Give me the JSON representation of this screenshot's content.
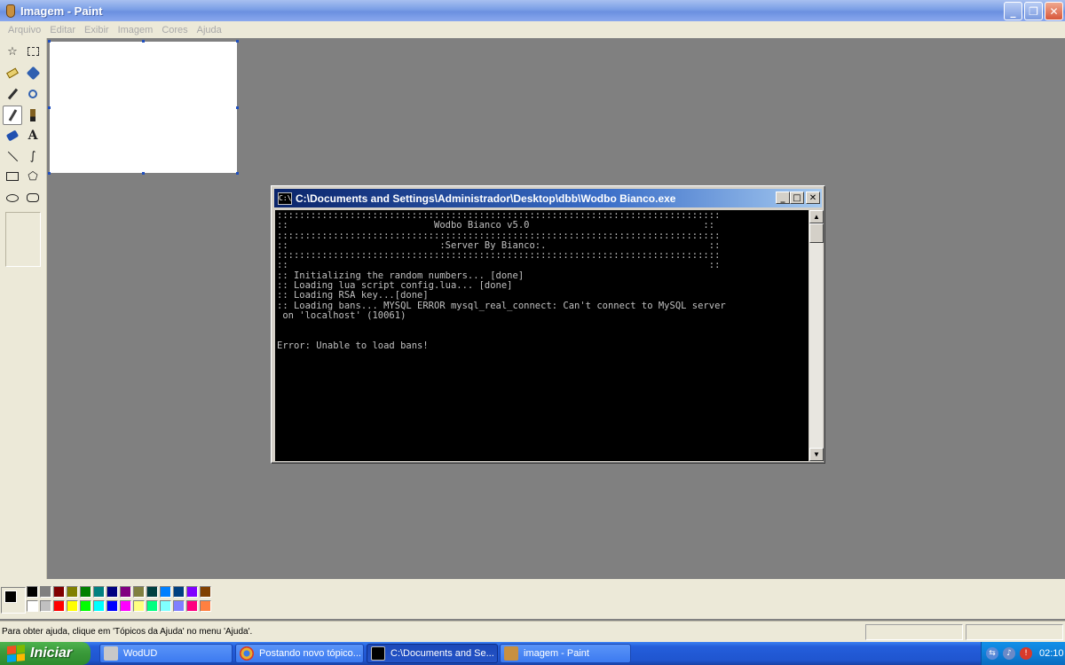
{
  "window": {
    "title": "Imagem - Paint"
  },
  "menu": [
    "Arquivo",
    "Editar",
    "Exibir",
    "Imagem",
    "Cores",
    "Ajuda"
  ],
  "console": {
    "title": "C:\\Documents and Settings\\Administrador\\Desktop\\dbb\\Wodbo Bianco.exe",
    "icon_text": "C:\\",
    "lines": [
      ":::::::::::::::::::::::::::::::::::::::::::::::::::::::::::::::::::::::::::::::",
      "::                          Wodbo Bianco v5.0                               ::",
      ":::::::::::::::::::::::::::::::::::::::::::::::::::::::::::::::::::::::::::::::",
      "::                           :Server By Bianco:.                             ::",
      ":::::::::::::::::::::::::::::::::::::::::::::::::::::::::::::::::::::::::::::::",
      "::                                                                           ::",
      ":: Initializing the random numbers... [done]",
      ":: Loading lua script config.lua... [done]",
      ":: Loading RSA key...[done]",
      ":: Loading bans... MYSQL ERROR mysql_real_connect: Can't connect to MySQL server",
      " on 'localhost' (10061)",
      "",
      "",
      "Error: Unable to load bans!"
    ]
  },
  "palette": {
    "top": [
      "#000000",
      "#808080",
      "#800000",
      "#808000",
      "#008000",
      "#008080",
      "#000080",
      "#800080",
      "#808040",
      "#004040",
      "#0080ff",
      "#004080",
      "#8000ff",
      "#804000"
    ],
    "bottom": [
      "#ffffff",
      "#c0c0c0",
      "#ff0000",
      "#ffff00",
      "#00ff00",
      "#00ffff",
      "#0000ff",
      "#ff00ff",
      "#ffff80",
      "#00ff80",
      "#80ffff",
      "#8080ff",
      "#ff0080",
      "#ff8040"
    ]
  },
  "status": {
    "text": "Para obter ajuda, clique em 'Tópicos da Ajuda' no menu 'Ajuda'."
  },
  "taskbar": {
    "start_label": "Iniciar",
    "tasks": [
      {
        "label": "WodUD",
        "icon": "wodud-icon",
        "icon_color": "#c8c8c8"
      },
      {
        "label": "Postando novo tópico...",
        "icon": "chrome-icon",
        "icon_color": "#e8b030"
      },
      {
        "label": "C:\\Documents and Se...",
        "icon": "cmd-icon",
        "icon_color": "#000000"
      },
      {
        "label": "imagem - Paint",
        "icon": "paint-icon",
        "icon_color": "#c89040"
      }
    ],
    "clock": "02:10"
  }
}
